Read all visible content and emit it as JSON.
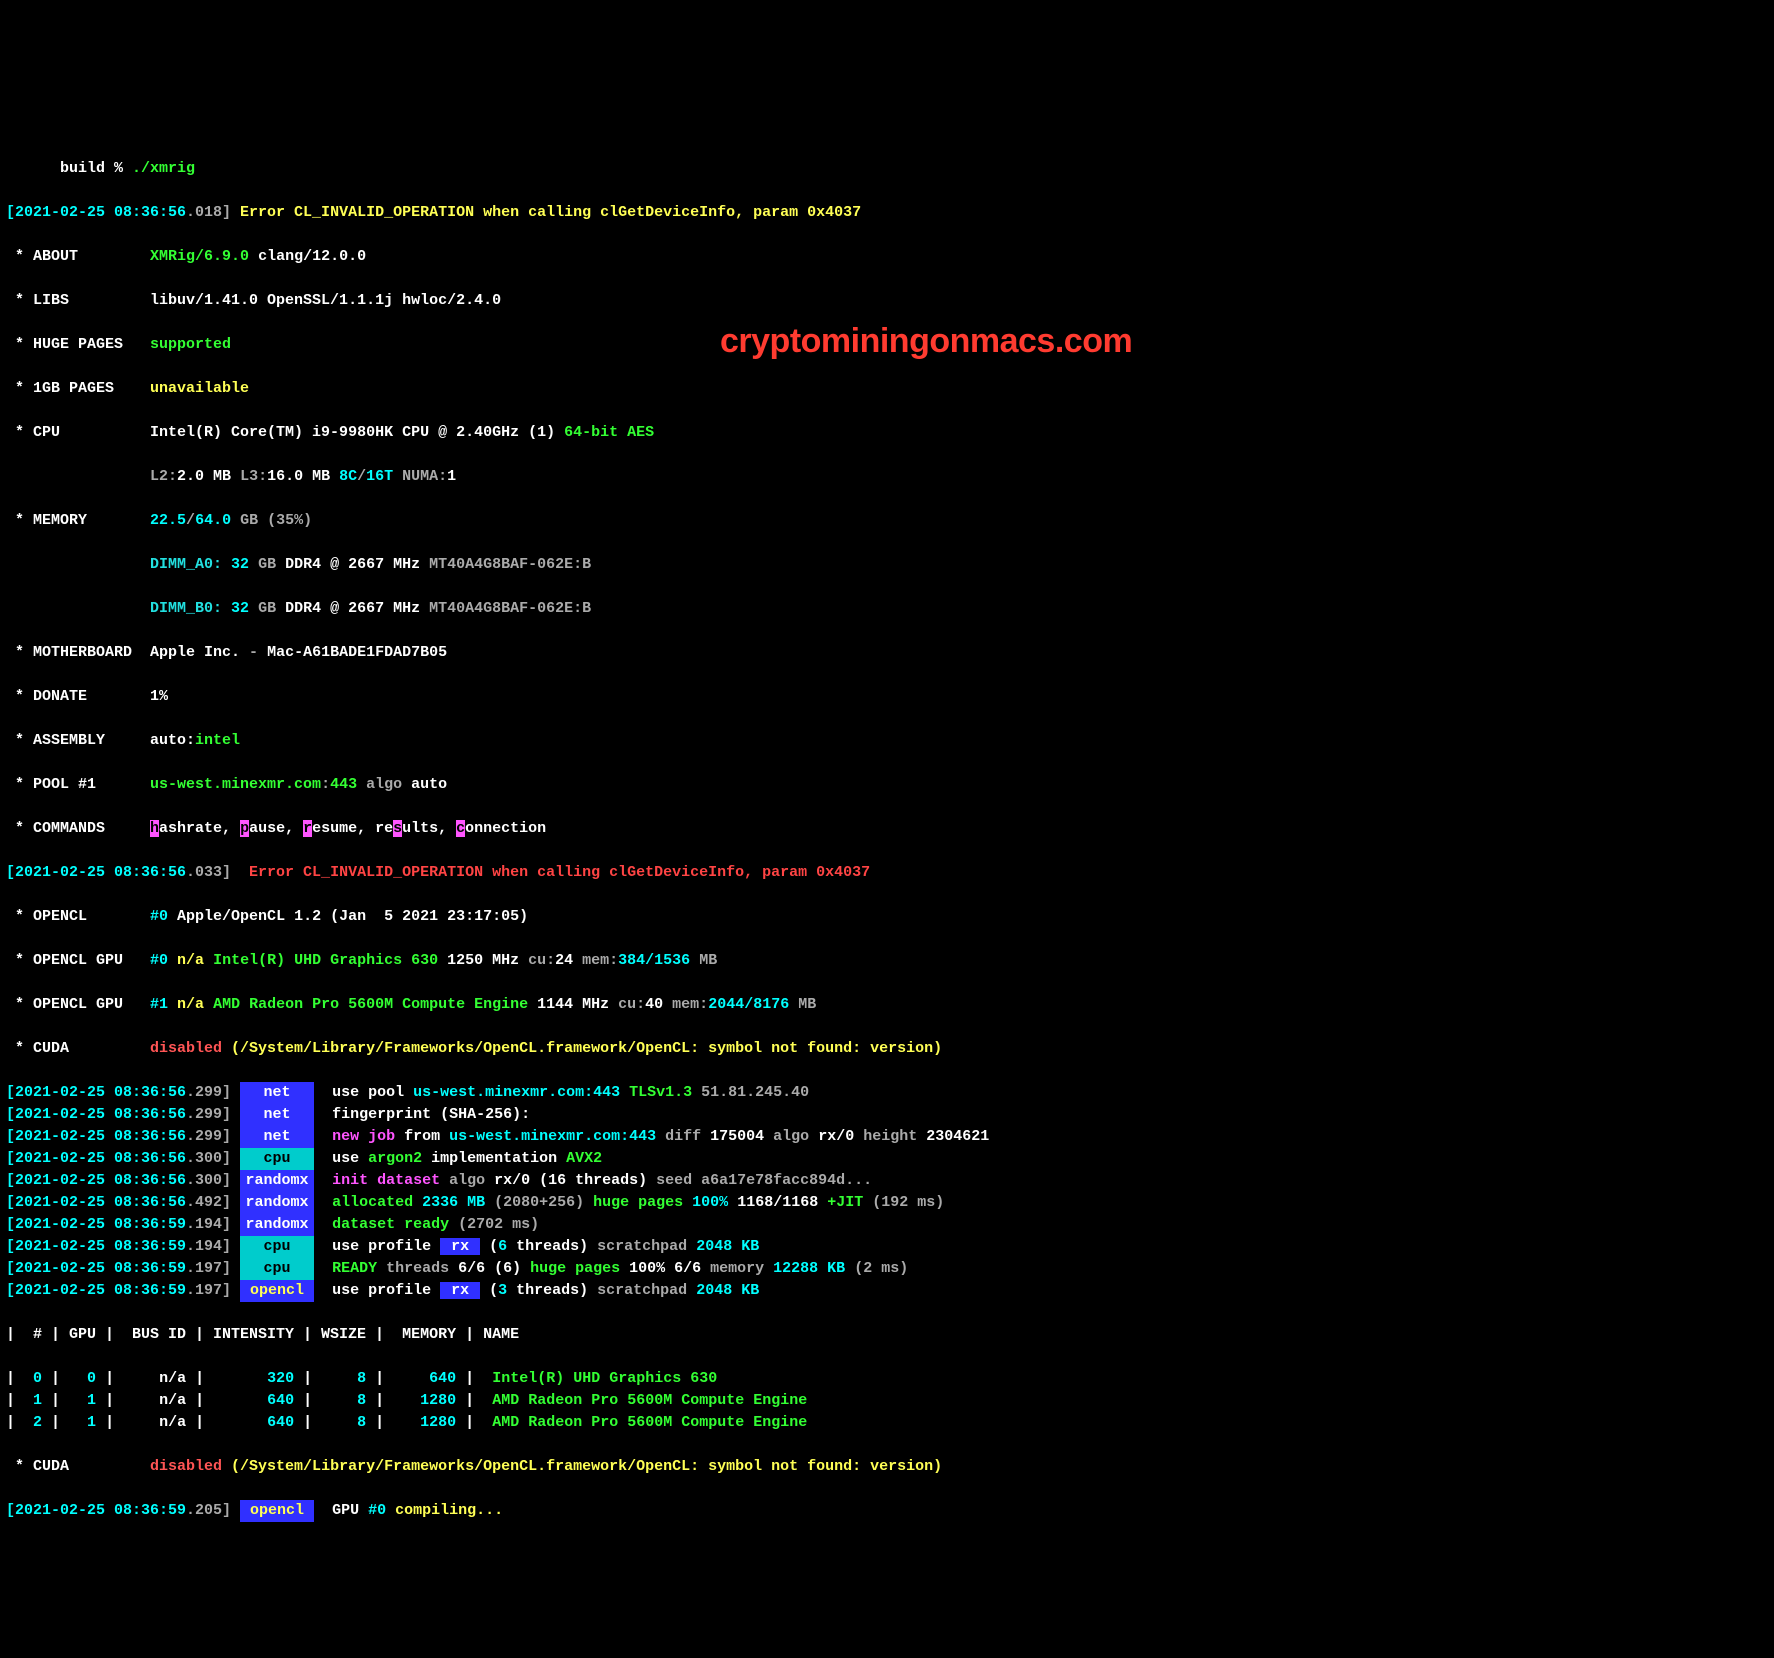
{
  "prompt": {
    "left": "      build % ",
    "cmd": "./xmrig"
  },
  "err1": {
    "ts_a": "[2021-02-25 08:36:56",
    "ts_b": ".018]",
    "msg": " Error CL_INVALID_OPERATION when calling clGetDeviceInfo, param 0x4037"
  },
  "about": {
    "key": " * ABOUT        ",
    "app": "XMRig/6.9.0",
    "compiler": " clang/12.0.0"
  },
  "libs": {
    "key": " * LIBS         ",
    "val": "libuv/1.41.0 OpenSSL/1.1.1j hwloc/2.4.0"
  },
  "huge": {
    "key": " * HUGE PAGES   ",
    "val": "supported"
  },
  "onegb": {
    "key": " * 1GB PAGES    ",
    "val": "unavailable"
  },
  "cpu": {
    "key": " * CPU          ",
    "name": "Intel(R) Core(TM) i9-9980HK CPU @ 2.40GHz (1) ",
    "feat": "64-bit AES"
  },
  "cache": {
    "pad": "                ",
    "l2a": "L2:",
    "l2v": "2.0 MB",
    "l3a": " L3:",
    "l3v": "16.0 MB ",
    "ct": "8C",
    "slash": "/",
    "th": "16T",
    "numa": " NUMA:",
    "numav": "1"
  },
  "mem": {
    "key": " * MEMORY       ",
    "used": "22.5",
    "slash": "/",
    "total": "64.0",
    "gb": " GB ",
    "pct": "(35%)"
  },
  "dimm0": {
    "pad": "                ",
    "slot": "DIMM_A0: ",
    "size": "32",
    "gb": " GB ",
    "spec": "DDR4 @ 2667 MHz ",
    "part": "MT40A4G8BAF-062E:B"
  },
  "dimm1": {
    "pad": "                ",
    "slot": "DIMM_B0: ",
    "size": "32",
    "gb": " GB ",
    "spec": "DDR4 @ 2667 MHz ",
    "part": "MT40A4G8BAF-062E:B"
  },
  "mb": {
    "key": " * MOTHERBOARD  ",
    "vendor": "Apple Inc.",
    "dash": " - ",
    "model": "Mac-A61BADE1FDAD7B05"
  },
  "donate": {
    "key": " * DONATE       ",
    "val": "1%"
  },
  "asm": {
    "key": " * ASSEMBLY     ",
    "a": "auto:",
    "b": "intel"
  },
  "pool": {
    "key": " * POOL #1      ",
    "host": "us-west.minexmr.com",
    "colon": ":",
    "port": "443",
    "algo": " algo ",
    "auto": "auto"
  },
  "cmds": {
    "key": " * COMMANDS     ",
    "h": "h",
    "h2": "ashrate, ",
    "p": "p",
    "p2": "ause, ",
    "r": "r",
    "r2": "esume, re",
    "s": "s",
    "s2": "ults, ",
    "c": "c",
    "c2": "onnection"
  },
  "err2": {
    "ts_a": "[2021-02-25 08:36:56",
    "ts_b": ".033]",
    "msg": "  Error CL_INVALID_OPERATION when calling clGetDeviceInfo, param 0x4037"
  },
  "ocl": {
    "key": " * OPENCL       ",
    "idx": "#0 ",
    "val": "Apple/OpenCL 1.2 (Jan  5 2021 23:17:05)"
  },
  "oclg0": {
    "key": " * OPENCL GPU   ",
    "idx": "#0 ",
    "na": "n/a ",
    "name": "Intel(R) UHD Graphics 630 ",
    "mhz": "1250 MHz",
    "cu1": " cu:",
    "cu2": "24",
    "mem1": " mem:",
    "mem2": "384/1536",
    "mb": " MB"
  },
  "oclg1": {
    "key": " * OPENCL GPU   ",
    "idx": "#1 ",
    "na": "n/a ",
    "name": "AMD Radeon Pro 5600M Compute Engine ",
    "mhz": "1144 MHz",
    "cu1": " cu:",
    "cu2": "40",
    "mem1": " mem:",
    "mem2": "2044/8176",
    "mb": " MB"
  },
  "cuda": {
    "key": " * CUDA         ",
    "dis": "disabled",
    "path": " (/System/Library/Frameworks/OpenCL.framework/OpenCL: symbol not found: version)"
  },
  "log": [
    {
      "tsa": "[2021-02-25 08:36:56",
      "tsb": ".299]",
      "tagclass": "c-blue-bg",
      "tag": "net",
      "msg": [
        {
          "t": "  use pool ",
          "c": "c-white"
        },
        {
          "t": "us-west.minexmr.com:443 ",
          "c": "c-cyan"
        },
        {
          "t": "TLSv1.3 ",
          "c": "c-green"
        },
        {
          "t": "51.81.245.40",
          "c": "c-grey"
        }
      ]
    },
    {
      "tsa": "[2021-02-25 08:36:56",
      "tsb": ".299]",
      "tagclass": "c-blue-bg",
      "tag": "net",
      "msg": [
        {
          "t": "  fingerprint (SHA-256): ",
          "c": "c-white"
        }
      ]
    },
    {
      "tsa": "[2021-02-25 08:36:56",
      "tsb": ".299]",
      "tagclass": "c-blue-bg",
      "tag": "net",
      "msg": [
        {
          "t": "  new job ",
          "c": "c-magenta"
        },
        {
          "t": "from ",
          "c": "c-white"
        },
        {
          "t": "us-west.minexmr.com:443 ",
          "c": "c-cyan"
        },
        {
          "t": "diff ",
          "c": "c-grey"
        },
        {
          "t": "175004",
          "c": "c-white"
        },
        {
          "t": " algo ",
          "c": "c-grey"
        },
        {
          "t": "rx/0",
          "c": "c-white"
        },
        {
          "t": " height ",
          "c": "c-grey"
        },
        {
          "t": "2304621",
          "c": "c-white"
        }
      ]
    },
    {
      "tsa": "[2021-02-25 08:36:56",
      "tsb": ".300]",
      "tagclass": "c-aqua-bg",
      "tag": "cpu",
      "msg": [
        {
          "t": "  use ",
          "c": "c-white"
        },
        {
          "t": "argon2",
          "c": "c-green"
        },
        {
          "t": " implementation ",
          "c": "c-white"
        },
        {
          "t": "AVX2",
          "c": "c-green"
        }
      ]
    },
    {
      "tsa": "[2021-02-25 08:36:56",
      "tsb": ".300]",
      "tagclass": "c-blue-bg",
      "tag": "randomx",
      "msg": [
        {
          "t": "  init dataset ",
          "c": "c-magenta"
        },
        {
          "t": "algo ",
          "c": "c-grey"
        },
        {
          "t": "rx/0 (16 threads) ",
          "c": "c-white"
        },
        {
          "t": "seed a6a17e78facc894d...",
          "c": "c-grey"
        }
      ]
    },
    {
      "tsa": "[2021-02-25 08:36:56",
      "tsb": ".492]",
      "tagclass": "c-blue-bg",
      "tag": "randomx",
      "msg": [
        {
          "t": "  allocated ",
          "c": "c-green"
        },
        {
          "t": "2336 MB ",
          "c": "c-cyan"
        },
        {
          "t": "(2080+256) ",
          "c": "c-grey"
        },
        {
          "t": "huge pages ",
          "c": "c-green"
        },
        {
          "t": "100% ",
          "c": "c-cyan"
        },
        {
          "t": "1168/1168 ",
          "c": "c-white"
        },
        {
          "t": "+JIT ",
          "c": "c-green"
        },
        {
          "t": "(192 ms)",
          "c": "c-grey"
        }
      ]
    },
    {
      "tsa": "[2021-02-25 08:36:59",
      "tsb": ".194]",
      "tagclass": "c-blue-bg",
      "tag": "randomx",
      "msg": [
        {
          "t": "  dataset ready ",
          "c": "c-green"
        },
        {
          "t": "(2702 ms)",
          "c": "c-grey"
        }
      ]
    },
    {
      "tsa": "[2021-02-25 08:36:59",
      "tsb": ".194]",
      "tagclass": "c-aqua-bg",
      "tag": "cpu",
      "msg": [
        {
          "t": "  use profile ",
          "c": "c-white"
        },
        {
          "t": " rx ",
          "c": "bg-rx"
        },
        {
          "t": " (",
          "c": "c-white"
        },
        {
          "t": "6",
          "c": "c-cyan"
        },
        {
          "t": " threads) ",
          "c": "c-white"
        },
        {
          "t": "scratchpad ",
          "c": "c-grey"
        },
        {
          "t": "2048 KB",
          "c": "c-cyan"
        }
      ]
    },
    {
      "tsa": "[2021-02-25 08:36:59",
      "tsb": ".197]",
      "tagclass": "c-aqua-bg",
      "tag": "cpu",
      "msg": [
        {
          "t": "  READY ",
          "c": "c-green"
        },
        {
          "t": "threads ",
          "c": "c-grey"
        },
        {
          "t": "6/6 (6) ",
          "c": "c-white"
        },
        {
          "t": "huge pages ",
          "c": "c-green"
        },
        {
          "t": "100% 6/6 ",
          "c": "c-white"
        },
        {
          "t": "memory ",
          "c": "c-grey"
        },
        {
          "t": "12288 KB ",
          "c": "c-cyan"
        },
        {
          "t": "(2 ms)",
          "c": "c-grey"
        }
      ]
    },
    {
      "tsa": "[2021-02-25 08:36:59",
      "tsb": ".197]",
      "tagclass": "c-blue-bg2",
      "tag": "opencl",
      "msg": [
        {
          "t": "  use profile ",
          "c": "c-white"
        },
        {
          "t": " rx ",
          "c": "bg-rx"
        },
        {
          "t": " (",
          "c": "c-white"
        },
        {
          "t": "3",
          "c": "c-cyan"
        },
        {
          "t": " threads) ",
          "c": "c-white"
        },
        {
          "t": "scratchpad ",
          "c": "c-grey"
        },
        {
          "t": "2048 KB",
          "c": "c-cyan"
        }
      ]
    }
  ],
  "tbl": {
    "hdr": "|  # | GPU |  BUS ID | INTENSITY | WSIZE |  MEMORY | NAME",
    "rows": [
      {
        "a": "|  ",
        "n": "0",
        "b": " |   ",
        "g": "0",
        "c": " |     n/a |       ",
        "i": "320",
        "d": " |     ",
        "w": "8",
        "e": " |     ",
        "m": "640",
        "f": " |  ",
        "name": "Intel(R) UHD Graphics 630"
      },
      {
        "a": "|  ",
        "n": "1",
        "b": " |   ",
        "g": "1",
        "c": " |     n/a |       ",
        "i": "640",
        "d": " |     ",
        "w": "8",
        "e": " |    ",
        "m": "1280",
        "f": " |  ",
        "name": "AMD Radeon Pro 5600M Compute Engine"
      },
      {
        "a": "|  ",
        "n": "2",
        "b": " |   ",
        "g": "1",
        "c": " |     n/a |       ",
        "i": "640",
        "d": " |     ",
        "w": "8",
        "e": " |    ",
        "m": "1280",
        "f": " |  ",
        "name": "AMD Radeon Pro 5600M Compute Engine"
      }
    ]
  },
  "cuda2": {
    "key": " * CUDA         ",
    "dis": "disabled",
    "path": " (/System/Library/Frameworks/OpenCL.framework/OpenCL: symbol not found: version)"
  },
  "compiling": {
    "tsa": "[2021-02-25 08:36:59",
    "tsb": ".205]",
    "tagclass": "c-blue-bg2",
    "tag": "opencl",
    "a": "  GPU ",
    "b": "#0 ",
    "c": "compiling..."
  },
  "watermark": "cryptominingonmacs.com"
}
